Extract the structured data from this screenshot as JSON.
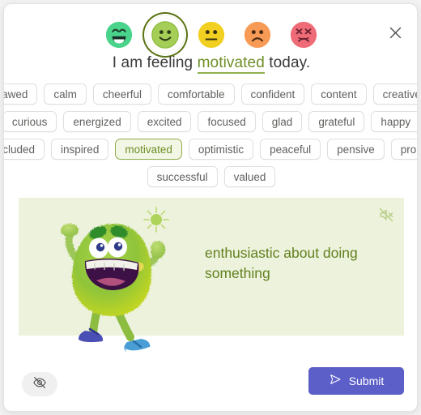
{
  "dialog": {
    "close_label": "Close",
    "close_icon": "close-icon"
  },
  "mood_scale": {
    "icon_name": "emoji-face",
    "selected_index": 1,
    "faces": [
      {
        "name": "very-happy",
        "color": "#4ad38a",
        "expression": "grinning",
        "selected": false
      },
      {
        "name": "happy",
        "color": "#9fcf4e",
        "expression": "smiling",
        "selected": true
      },
      {
        "name": "neutral",
        "color": "#f2d022",
        "expression": "neutral",
        "selected": false
      },
      {
        "name": "sad",
        "color": "#f79a55",
        "expression": "frowning",
        "selected": false
      },
      {
        "name": "distressed",
        "color": "#ef6b78",
        "expression": "confounded",
        "selected": false
      }
    ]
  },
  "sentence": {
    "prefix": "I am feeling ",
    "word": "motivated",
    "suffix": " today."
  },
  "chips": {
    "rows": [
      [
        "awed",
        "calm",
        "cheerful",
        "comfortable",
        "confident",
        "content",
        "creative"
      ],
      [
        "curious",
        "energized",
        "excited",
        "focused",
        "glad",
        "grateful",
        "happy"
      ],
      [
        "included",
        "inspired",
        "motivated",
        "optimistic",
        "peaceful",
        "pensive",
        "proud"
      ],
      [
        "successful",
        "valued"
      ]
    ],
    "selected": "motivated"
  },
  "illustration": {
    "definition": "enthusiastic about doing something",
    "mute_icon": "speaker-muted-icon",
    "character": "green-fuzzy-monster",
    "background_color": "#edf2dc",
    "text_color": "#62801f"
  },
  "footer": {
    "hide_icon": "eye-slash-icon",
    "hide_label": "",
    "submit_label": "Submit",
    "submit_icon": "send-icon",
    "submit_color": "#5b5fc7"
  }
}
